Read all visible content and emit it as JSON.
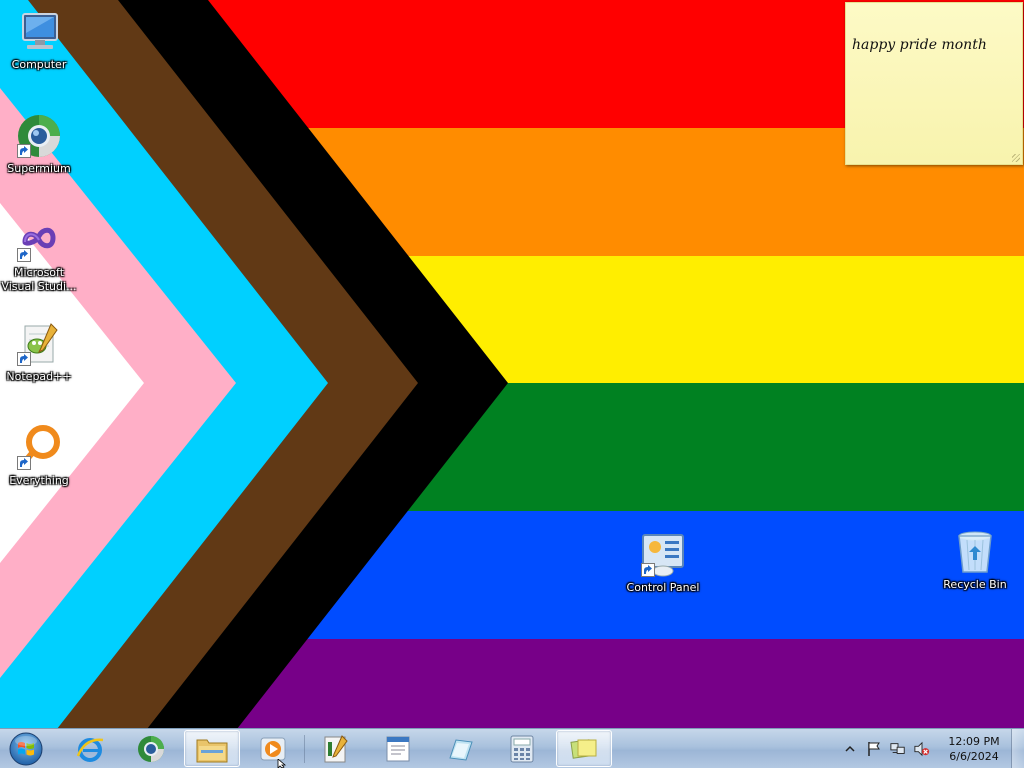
{
  "desktop": {
    "icons": [
      {
        "id": "computer",
        "label": "Computer",
        "icon": "computer-icon"
      },
      {
        "id": "supermium",
        "label": "Supermium",
        "icon": "supermium-browser-icon"
      },
      {
        "id": "visual-studio",
        "label": "Microsoft Visual Studi...",
        "icon": "visual-studio-icon"
      },
      {
        "id": "notepadpp",
        "label": "Notepad++",
        "icon": "notepad-plus-plus-icon"
      },
      {
        "id": "everything",
        "label": "Everything",
        "icon": "everything-search-icon"
      },
      {
        "id": "control-panel",
        "label": "Control Panel",
        "icon": "control-panel-icon"
      },
      {
        "id": "recycle-bin",
        "label": "Recycle Bin",
        "icon": "recycle-bin-icon"
      }
    ],
    "wallpaper": {
      "stripes": [
        "#ff0000",
        "#ff8c00",
        "#ffee00",
        "#008121",
        "#004cff",
        "#770088"
      ],
      "chevrons": [
        "#000000",
        "#613915",
        "#00d0ff",
        "#ffafc7",
        "#ffffff"
      ]
    }
  },
  "sticky_note": {
    "text": "happy pride month"
  },
  "taskbar": {
    "start_icon": "windows-orb-icon",
    "pinned": [
      {
        "id": "ie",
        "icon": "internet-explorer-icon",
        "active": false
      },
      {
        "id": "supermium",
        "icon": "supermium-browser-icon",
        "active": false
      },
      {
        "id": "explorer",
        "icon": "file-explorer-icon",
        "active": true
      },
      {
        "id": "media",
        "icon": "media-player-icon",
        "active": false
      },
      {
        "id": "notepadpp",
        "icon": "notepad-plus-plus-icon",
        "active": false
      },
      {
        "id": "wordpad",
        "icon": "wordpad-icon",
        "active": false
      },
      {
        "id": "snipping",
        "icon": "snipping-tool-icon",
        "active": false
      },
      {
        "id": "calculator",
        "icon": "calculator-icon",
        "active": false
      },
      {
        "id": "sticky-notes",
        "icon": "sticky-notes-icon",
        "active": true
      }
    ],
    "tray": {
      "icons": [
        "show-hidden-icons-chevron",
        "action-center-flag-icon",
        "network-icon",
        "volume-muted-icon"
      ]
    },
    "clock": {
      "time": "12:09 PM",
      "date": "6/6/2024"
    }
  }
}
